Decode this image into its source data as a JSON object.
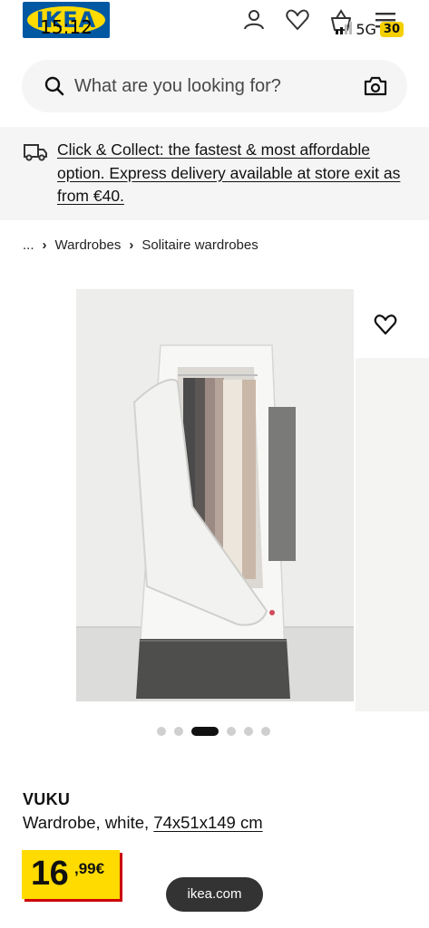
{
  "status_bar": {
    "time": "15:12",
    "network": "5G",
    "battery": "30",
    "signal_bars": 2
  },
  "header": {
    "logo_text": "IKEA",
    "icons": [
      "person-icon",
      "heart-icon",
      "shopping-bag-icon",
      "menu-icon"
    ]
  },
  "search": {
    "placeholder": "What are you looking for?",
    "value": ""
  },
  "banner": {
    "text": "Click & Collect: the fastest & most affordable option. Express delivery available at store exit as from €40."
  },
  "breadcrumb": {
    "items": [
      "...",
      "Wardrobes",
      "Solitaire wardrobes"
    ]
  },
  "carousel": {
    "image_count": 6,
    "active_index": 2
  },
  "product": {
    "name": "VUKU",
    "description": "Wardrobe, white,",
    "dimensions": "74x51x149 cm",
    "price_integer": "16",
    "price_decimal": ",99€"
  },
  "browser": {
    "url": "ikea.com"
  },
  "colors": {
    "brand_blue": "#0058a3",
    "brand_yellow": "#ffdb00",
    "price_shadow": "#cc0008"
  }
}
